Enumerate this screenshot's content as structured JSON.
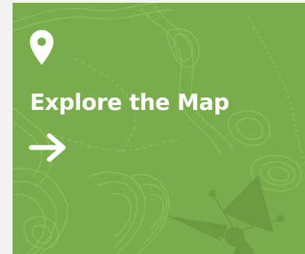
{
  "card": {
    "title": "Explore the Map",
    "icons": {
      "top": "map-pin-icon",
      "bottom": "arrow-right-icon"
    },
    "colors": {
      "background": "#79ad4c",
      "contour": "#93c36a",
      "compass": "#6c9a43",
      "text": "#ffffff"
    }
  }
}
